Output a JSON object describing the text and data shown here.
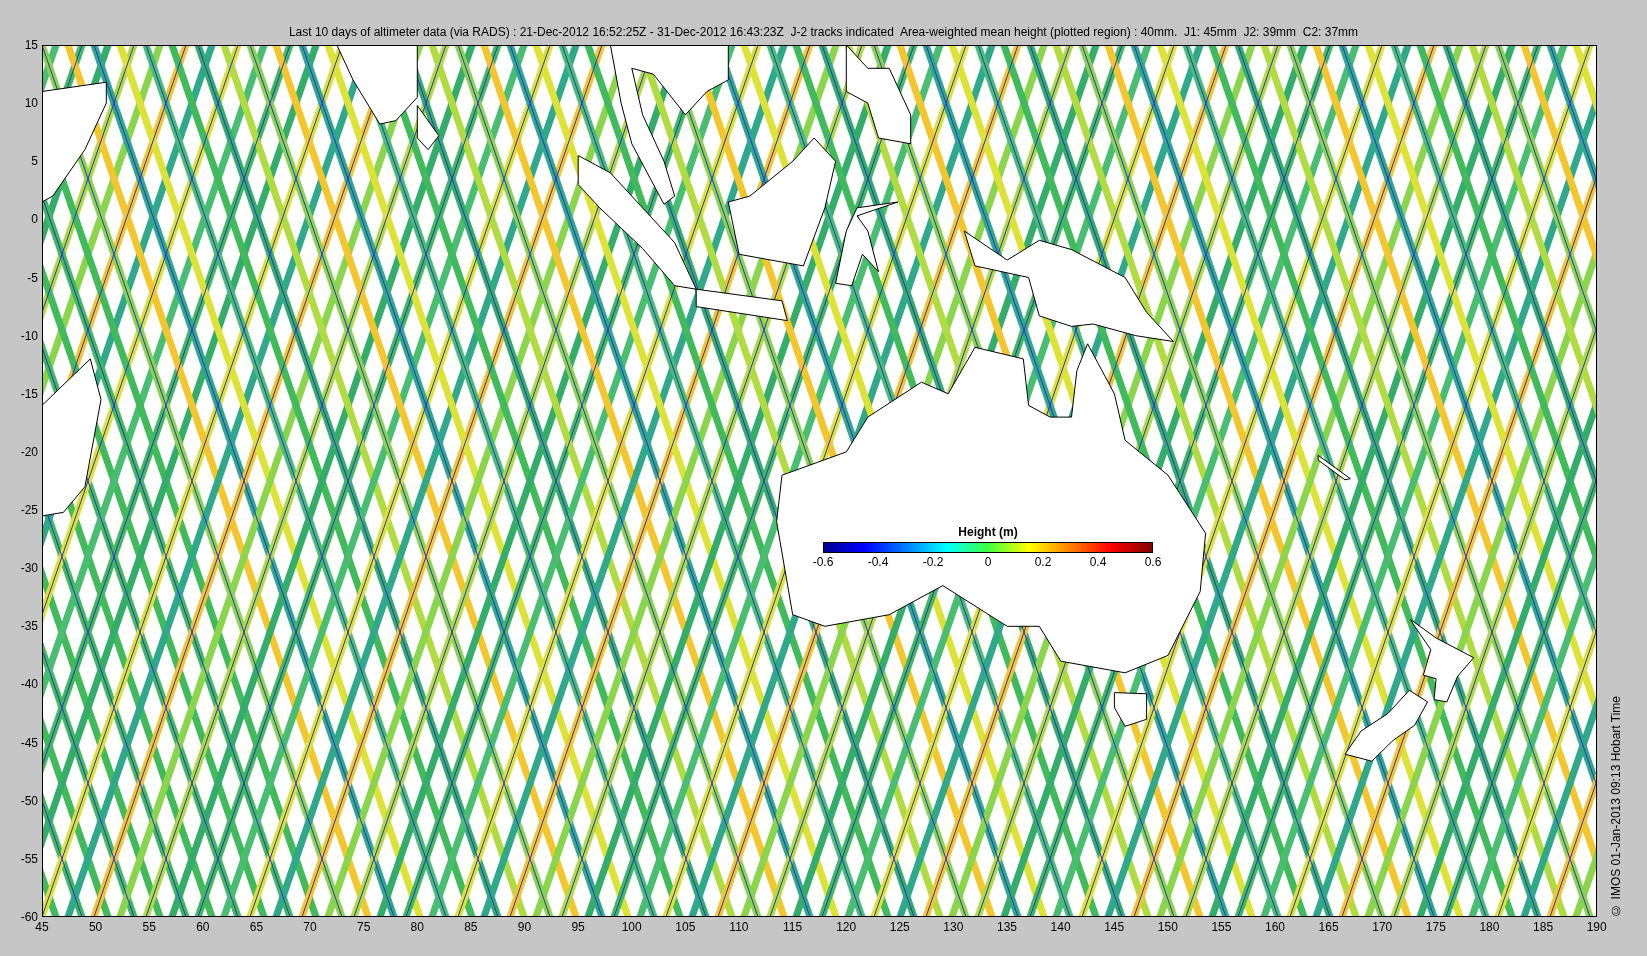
{
  "title": "Last 10 days of altimeter data (via RADS) : 21-Dec-2012 16:52:25Z - 31-Dec-2012 16:43:23Z  J-2 tracks indicated  Area-weighted mean height (plotted region) : 40mm.  J1: 45mm  J2: 39mm  C2: 37mm",
  "y_axis": {
    "ticks": [
      "15",
      "10",
      "5",
      "0",
      "-5",
      "-10",
      "-15",
      "-20",
      "-25",
      "-30",
      "-35",
      "-40",
      "-45",
      "-50",
      "-55",
      "-60"
    ]
  },
  "x_axis": {
    "ticks": [
      "45",
      "50",
      "55",
      "60",
      "65",
      "70",
      "75",
      "80",
      "85",
      "90",
      "95",
      "100",
      "105",
      "110",
      "115",
      "120",
      "125",
      "130",
      "135",
      "140",
      "145",
      "150",
      "155",
      "160",
      "165",
      "170",
      "175",
      "180",
      "185",
      "190"
    ]
  },
  "colorbar": {
    "title": "Height (m)",
    "ticks": [
      "-0.6",
      "-0.4",
      "-0.2",
      "0",
      "0.2",
      "0.4",
      "0.6"
    ]
  },
  "credit": "© IMOS 01-Jan-2013 09:13 Hobart Time"
}
